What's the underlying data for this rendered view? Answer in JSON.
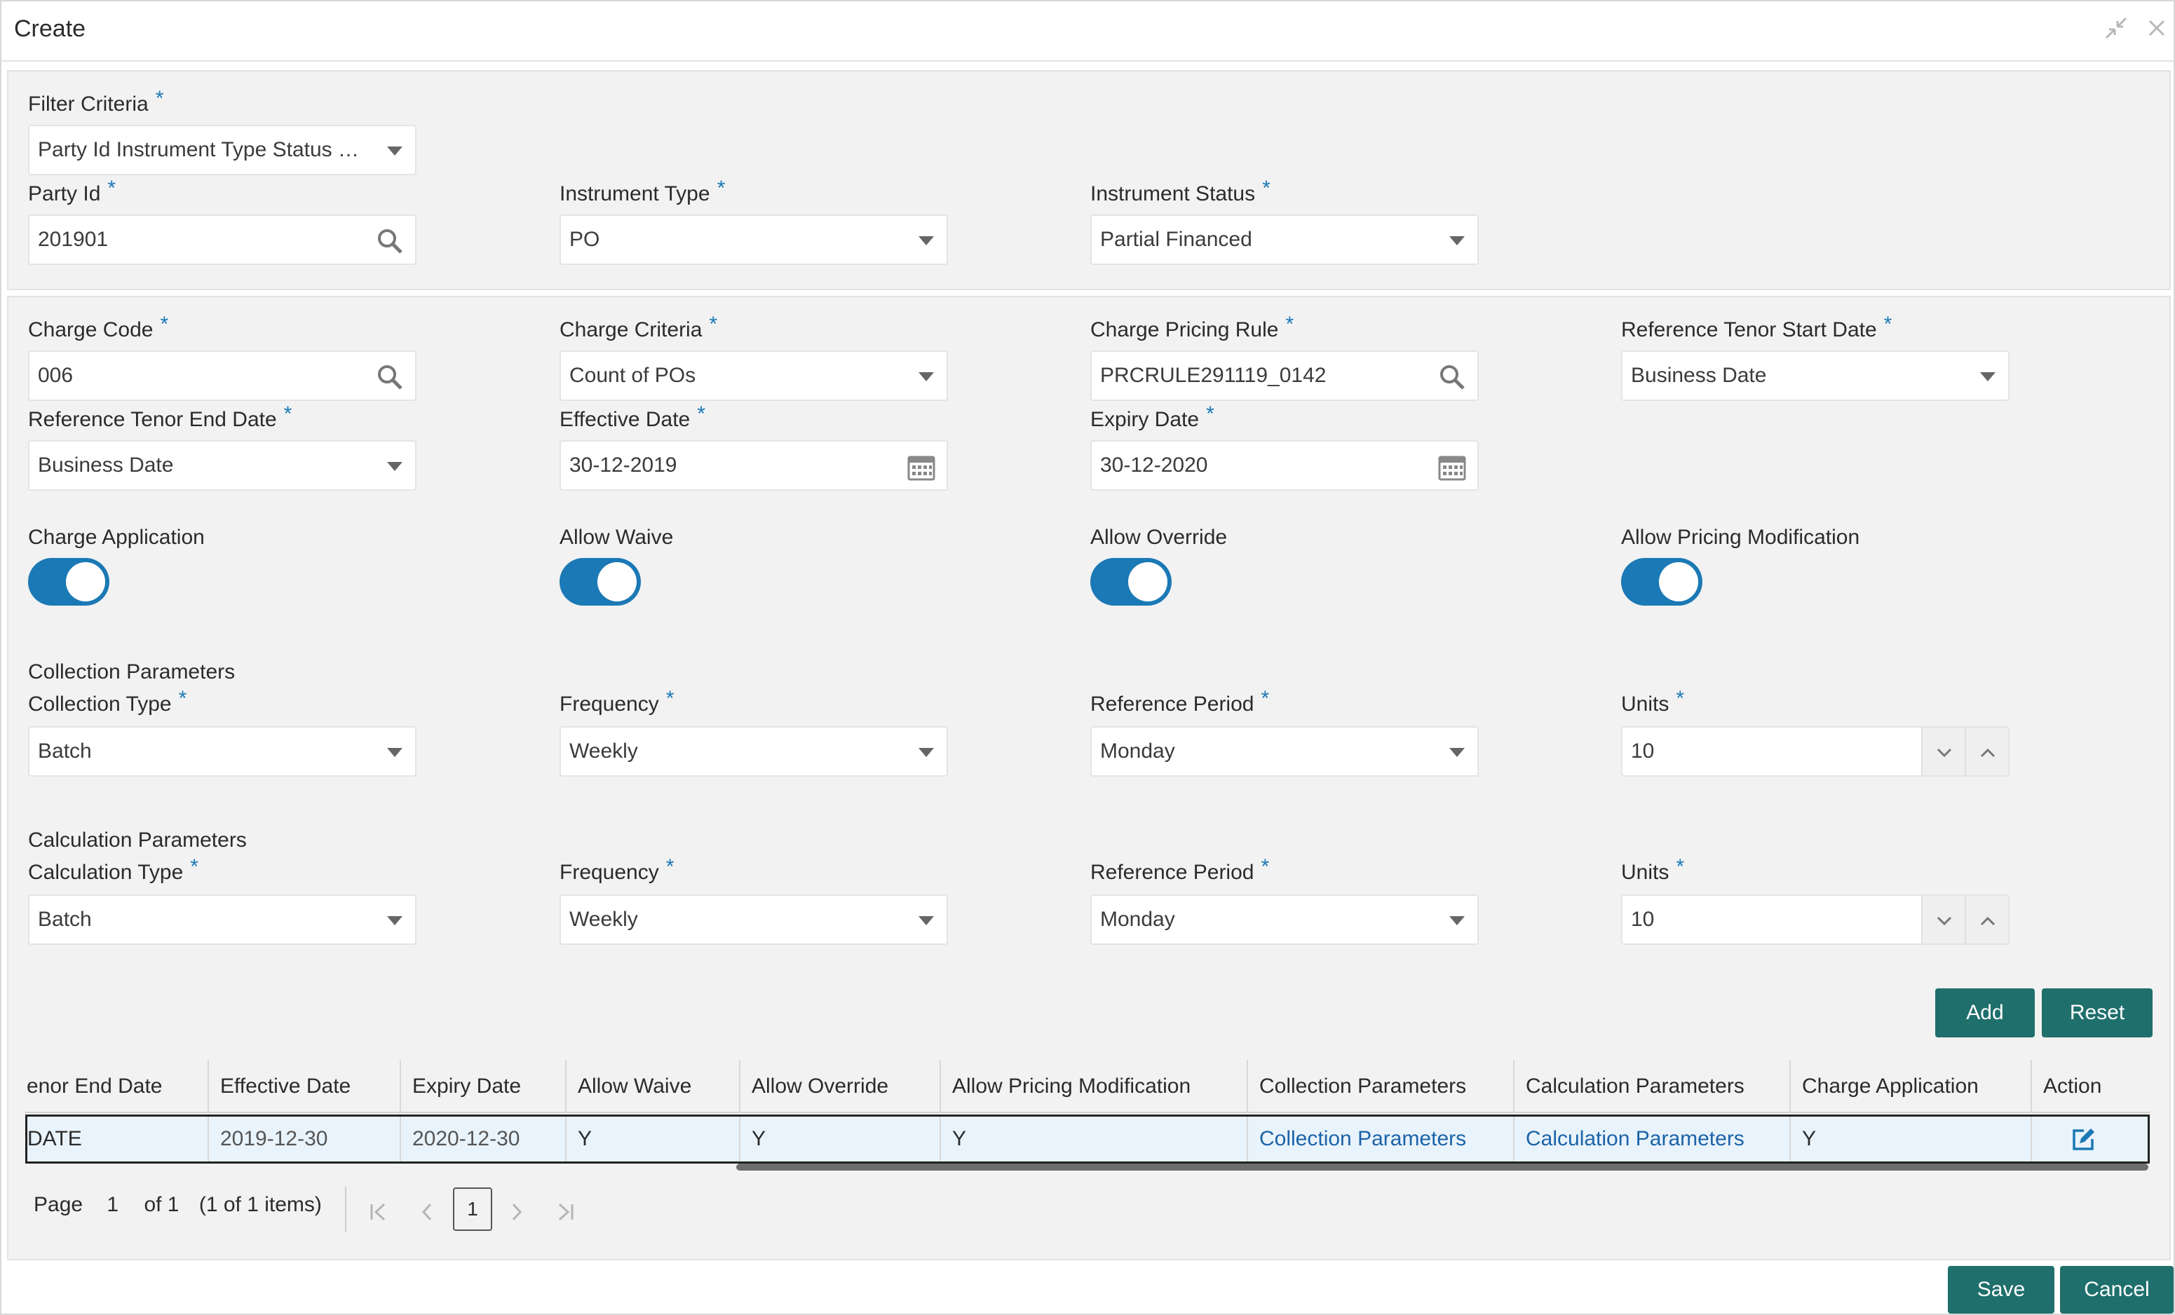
{
  "window": {
    "title": "Create"
  },
  "filter": {
    "criteria_label": "Filter Criteria",
    "criteria_value": "Party Id Instrument Type Status B...",
    "party_id_label": "Party Id",
    "party_id_value": "201901",
    "instrument_type_label": "Instrument Type",
    "instrument_type_value": "PO",
    "instrument_status_label": "Instrument Status",
    "instrument_status_value": "Partial Financed"
  },
  "charge": {
    "code_label": "Charge Code",
    "code_value": "006",
    "criteria_label": "Charge Criteria",
    "criteria_value": "Count of POs",
    "pricing_rule_label": "Charge Pricing Rule",
    "pricing_rule_value": "PRCRULE291119_0142",
    "tenor_start_label": "Reference Tenor Start Date",
    "tenor_start_value": "Business Date",
    "tenor_end_label": "Reference Tenor End Date",
    "tenor_end_value": "Business Date",
    "effective_label": "Effective Date",
    "effective_value": "30-12-2019",
    "expiry_label": "Expiry Date",
    "expiry_value": "30-12-2020",
    "application_label": "Charge Application",
    "waive_label": "Allow Waive",
    "override_label": "Allow Override",
    "pricing_mod_label": "Allow Pricing Modification",
    "toggles": {
      "application": true,
      "waive": true,
      "override": true,
      "pricing_mod": true
    }
  },
  "collection": {
    "section_label": "Collection Parameters",
    "type_label": "Collection Type",
    "type_value": "Batch",
    "frequency_label": "Frequency",
    "frequency_value": "Weekly",
    "period_label": "Reference Period",
    "period_value": "Monday",
    "units_label": "Units",
    "units_value": "10"
  },
  "calculation": {
    "section_label": "Calculation Parameters",
    "type_label": "Calculation Type",
    "type_value": "Batch",
    "frequency_label": "Frequency",
    "frequency_value": "Weekly",
    "period_label": "Reference Period",
    "period_value": "Monday",
    "units_label": "Units",
    "units_value": "10"
  },
  "actions": {
    "add": "Add",
    "reset": "Reset",
    "save": "Save",
    "cancel": "Cancel"
  },
  "table": {
    "headers": [
      "enor End Date",
      "Effective Date",
      "Expiry Date",
      "Allow Waive",
      "Allow Override",
      "Allow Pricing Modification",
      "Collection Parameters",
      "Calculation Parameters",
      "Charge Application",
      "Action"
    ],
    "row": [
      "DATE",
      "2019-12-30",
      "2020-12-30",
      "Y",
      "Y",
      "Y",
      "Collection Parameters",
      "Calculation Parameters",
      "Y"
    ]
  },
  "pager": {
    "page_label": "Page",
    "page": "1",
    "of_label": "of 1",
    "items": "(1 of 1 items)",
    "current": "1"
  },
  "colors": {
    "accent": "#1b79b5",
    "button": "#1f6f6c",
    "link": "#1b63a8",
    "required": "#1b79b5"
  }
}
